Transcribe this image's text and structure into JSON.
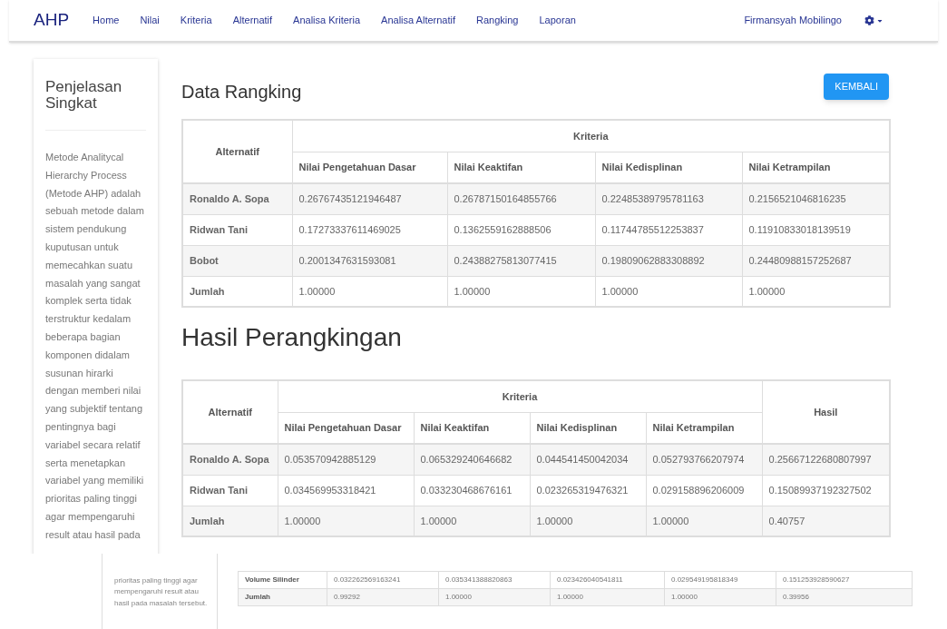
{
  "navbar": {
    "brand": "AHP",
    "links": [
      {
        "label": "Home"
      },
      {
        "label": "Nilai"
      },
      {
        "label": "Kriteria"
      },
      {
        "label": "Alternatif"
      },
      {
        "label": "Analisa Kriteria"
      },
      {
        "label": "Analisa Alternatif"
      },
      {
        "label": "Rangking"
      },
      {
        "label": "Laporan"
      }
    ],
    "user": "Firmansyah Mobilingo"
  },
  "sidebar": {
    "title": "Penjelasan Singkat",
    "text": "Metode Analitycal Hierarchy Process (Metode AHP) adalah sebuah metode dalam sistem pendukung kuputusan untuk memecahkan suatu masalah yang sangat komplek serta tidak terstruktur kedalam beberapa bagian komponen didalam susunan hirarki dengan memberi nilai yang subjektif tentang pentingnya bagi variabel secara relatif serta menetapkan variabel yang memiliki prioritas paling tinggi agar mempengaruhi result atau hasil pada"
  },
  "ranking": {
    "title": "Data Rangking",
    "button": "KEMBALI",
    "table": {
      "row_header": "Alternatif",
      "group_header": "Kriteria",
      "columns": [
        "Nilai Pengetahuan Dasar",
        "Nilai Keaktifan",
        "Nilai Kedisplinan",
        "Nilai Ketrampilan"
      ],
      "rows": [
        {
          "name": "Ronaldo A. Sopa",
          "cells": [
            "0.26767435121946487",
            "0.26787150164855766",
            "0.22485389795781163",
            "0.2156521046816235"
          ]
        },
        {
          "name": "Ridwan Tani",
          "cells": [
            "0.17273337611469025",
            "0.1362559162888506",
            "0.11744785512253837",
            "0.11910833018139519"
          ]
        },
        {
          "name": "Bobot",
          "cells": [
            "0.2001347631593081",
            "0.24388275813077415",
            "0.19809062883308892",
            "0.24480988157252687"
          ]
        },
        {
          "name": "Jumlah",
          "cells": [
            "1.00000",
            "1.00000",
            "1.00000",
            "1.00000"
          ]
        }
      ]
    }
  },
  "result": {
    "title": "Hasil Perangkingan",
    "table": {
      "row_header": "Alternatif",
      "group_header": "Kriteria",
      "result_header": "Hasil",
      "columns": [
        "Nilai Pengetahuan Dasar",
        "Nilai Keaktifan",
        "Nilai Kedisplinan",
        "Nilai Ketrampilan"
      ],
      "rows": [
        {
          "name": "Ronaldo A. Sopa",
          "cells": [
            "0.053570942885129",
            "0.065329240646682",
            "0.044541450042034",
            "0.052793766207974",
            "0.25667122680807997"
          ]
        },
        {
          "name": "Ridwan Tani",
          "cells": [
            "0.034569953318421",
            "0.033230468676161",
            "0.023265319476321",
            "0.029158896206009",
            "0.15089937192327502"
          ]
        },
        {
          "name": "Jumlah",
          "cells": [
            "1.00000",
            "1.00000",
            "1.00000",
            "1.00000",
            "0.40757"
          ]
        }
      ]
    }
  },
  "overlay_fragment": {
    "sidebar_text": "prioritas paling tinggi agar mempengaruhi result atau hasil pada masalah tersebut.",
    "rows": [
      {
        "name": "Volume Silinder",
        "cells": [
          "0.032262569163241",
          "0.035341388820863",
          "0.023426040541811",
          "0.029549195818349",
          "0.151253928590627"
        ]
      },
      {
        "name": "Jumlah",
        "cells": [
          "0.99292",
          "1.00000",
          "1.00000",
          "1.00000",
          "0.39956"
        ]
      }
    ]
  }
}
